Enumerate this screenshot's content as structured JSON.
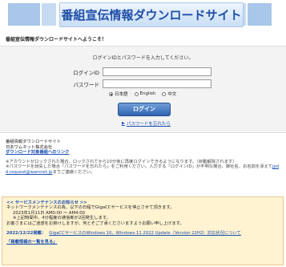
{
  "header": {
    "title": "番組宣伝情報ダウンロードサイト"
  },
  "welcome": "番組宣伝情報ダウンロードサイトへようこそ！",
  "login": {
    "message": "ログインIDとパスワードを入力してください。",
    "id_label": "ログインID",
    "id_value": "",
    "password_label": "パスワード",
    "password_value": "",
    "languages": [
      {
        "label": "日本語",
        "selected": true
      },
      {
        "label": "English",
        "selected": false
      },
      {
        "label": "中文",
        "selected": false
      }
    ],
    "button_label": "ログイン",
    "forgot_label": "パスワードを忘れたら"
  },
  "info": {
    "site_name": "番組情報ダウンロードサイト",
    "company": "日本ワムネット株式会社",
    "link_label": "ダウンロード対象番組へのリンク",
    "lock_note": "※アカウントがロックされた場合、ロックされてから10分後に再度ログインできるようになります。（目動解除されます）",
    "forgot_note_1": "※パスワードを紛失した場合「パスワードを忘れたら」をご利用ください。入力する「ログインID」が不明な場合、御社名、お名前を添えて",
    "email_1": "jpd",
    "email_2": "d.request@wamnet.jp",
    "forgot_note_2": "までご連絡ください。"
  },
  "maintenance": {
    "title": "<< サービスメンテナンスのお知らせ >>",
    "line1": "ネットワークメンテナンスの為、以下の日程でGigaCCサービスを停止させて頂きます。",
    "line2": "2023年1月11日 AM0:00 ～ AM4:00",
    "line3": "※上記時間中、4分程度の通信断が2回発生します。",
    "line4": "お客さまにはご迷惑をお掛けしますが、何とぞご了承くださいますようお願い申し上げます。",
    "news_date": "2022/12/22掲載：",
    "news_link": "GigaCCサービスのWindows 10、Windows 11 2022 Update（Version 22H2）対応状況について",
    "list_link": "「掲載情報の一覧を見る」"
  }
}
